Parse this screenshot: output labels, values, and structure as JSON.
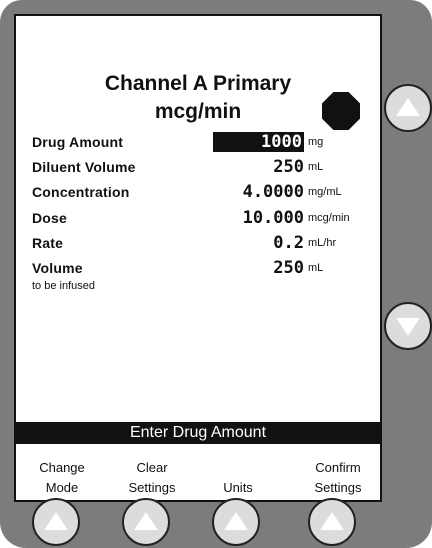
{
  "screen": {
    "title": "Channel A Primary",
    "subtitle": "mcg/min",
    "rows": [
      {
        "label": "Drug Amount",
        "value": "1000",
        "unit": "mg"
      },
      {
        "label": "Diluent Volume",
        "value": "250",
        "unit": "mL"
      },
      {
        "label": "Concentration",
        "value": "4.0000",
        "unit": "mg/mL"
      },
      {
        "label": "Dose",
        "value": "10.000",
        "unit": "mcg/min"
      },
      {
        "label": "Rate",
        "value": "0.2",
        "unit": "mL/hr"
      },
      {
        "label": "Volume",
        "value": "250",
        "unit": "mL",
        "sublabel": "to be infused"
      }
    ],
    "prompt": "Enter Drug Amount"
  },
  "softkeys": [
    {
      "line1": "Change",
      "line2": "Mode"
    },
    {
      "line1": "Clear",
      "line2": "Settings"
    },
    {
      "line1": "",
      "line2": "Units"
    },
    {
      "line1": "Confirm",
      "line2": "Settings"
    }
  ],
  "icons": {
    "stop": "stop-octagon-icon",
    "up": "up-arrow-icon",
    "down": "down-arrow-icon"
  },
  "colors": {
    "bezel": "#7c7c7c",
    "screen": "#ffffff",
    "highlight": "#111111"
  }
}
